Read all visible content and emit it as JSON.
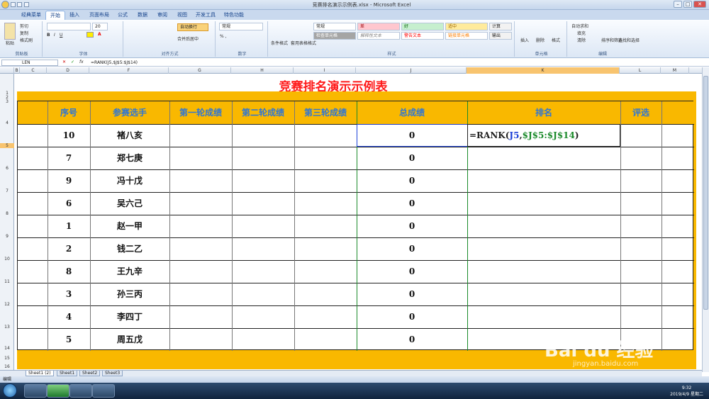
{
  "window": {
    "title": "竞赛排名演示示例表.xlsx - Microsoft Excel",
    "min": "–",
    "max": "□",
    "close": "✕"
  },
  "ribbon_tabs": [
    "经典菜单",
    "开始",
    "插入",
    "页面布局",
    "公式",
    "数据",
    "审阅",
    "视图",
    "开发工具",
    "特色功能"
  ],
  "ribbon": {
    "clipboard": {
      "paste": "粘贴",
      "cut": "剪切",
      "copy": "复制",
      "format_painter": "格式刷",
      "label": "剪贴板"
    },
    "font": {
      "label": "字体",
      "size": "20"
    },
    "alignment": {
      "wrap": "自动换行",
      "merge": "合并后居中",
      "label": "对齐方式"
    },
    "number": {
      "format": "常规",
      "label": "数字"
    },
    "styles": {
      "cond": "条件格式",
      "table": "套用表格格式",
      "s_normal": "常规",
      "s_bad": "差",
      "s_good": "好",
      "s_neutral": "适中",
      "s_check": "检查单元格",
      "s_explain": "解释性文本",
      "s_warn": "警告文本",
      "s_link": "链接单元格",
      "s_output": "输出",
      "s_calc": "计算",
      "label": "样式"
    },
    "cells": {
      "insert": "插入",
      "delete": "删除",
      "format": "格式",
      "label": "单元格"
    },
    "editing": {
      "autosum": "自动求和",
      "fill": "填充",
      "clear": "清除",
      "sort": "排序和筛选",
      "find": "查找和选择",
      "label": "编辑"
    }
  },
  "formula_bar": {
    "name_box": "LEN",
    "formula": "=RANK(J5,$J$5:$J$14)"
  },
  "columns": [
    "B",
    "C",
    "D",
    "F",
    "G",
    "H",
    "I",
    "J",
    "K",
    "L",
    "M"
  ],
  "rows": [
    "1",
    "2",
    "3",
    "4",
    "5",
    "6",
    "7",
    "8",
    "9",
    "10",
    "11",
    "12",
    "13",
    "14",
    "15",
    "16"
  ],
  "sheet": {
    "title": "竞赛排名演示示例表",
    "headers": [
      "序号",
      "参赛选手",
      "第一轮成绩",
      "第二轮成绩",
      "第三轮成绩",
      "总成绩",
      "排名",
      "评选"
    ],
    "rows": [
      {
        "no": "10",
        "name": "褚八亥",
        "total": "0"
      },
      {
        "no": "7",
        "name": "郑七庚",
        "total": "0"
      },
      {
        "no": "9",
        "name": "冯十戊",
        "total": "0"
      },
      {
        "no": "6",
        "name": "吴六己",
        "total": "0"
      },
      {
        "no": "1",
        "name": "赵一甲",
        "total": "0"
      },
      {
        "no": "2",
        "name": "钱二乙",
        "total": "0"
      },
      {
        "no": "8",
        "name": "王九辛",
        "total": "0"
      },
      {
        "no": "3",
        "name": "孙三丙",
        "total": "0"
      },
      {
        "no": "4",
        "name": "李四丁",
        "total": "0"
      },
      {
        "no": "5",
        "name": "周五戊",
        "total": "0"
      }
    ],
    "editing_formula": {
      "prefix": "=RANK(",
      "ref": "J5",
      "comma": ",",
      "range": "$J$5:$J$14",
      "suffix": ")"
    }
  },
  "sheet_tabs": [
    "Sheet1 (2)",
    "Sheet1",
    "Sheet2",
    "Sheet3"
  ],
  "status": {
    "mode": "编辑"
  },
  "taskbar": {
    "time": "9:32",
    "date": "2019/4/9 星期二"
  },
  "watermark": {
    "brand": "Bai du 经验",
    "url": "jingyan.baidu.com"
  },
  "colors": {
    "title_red": "#ff1a1a",
    "header_blue": "#2f76d4",
    "band_orange": "#f9b800",
    "ref_blue": "#1a3fd8",
    "range_green": "#1a8a2a"
  }
}
